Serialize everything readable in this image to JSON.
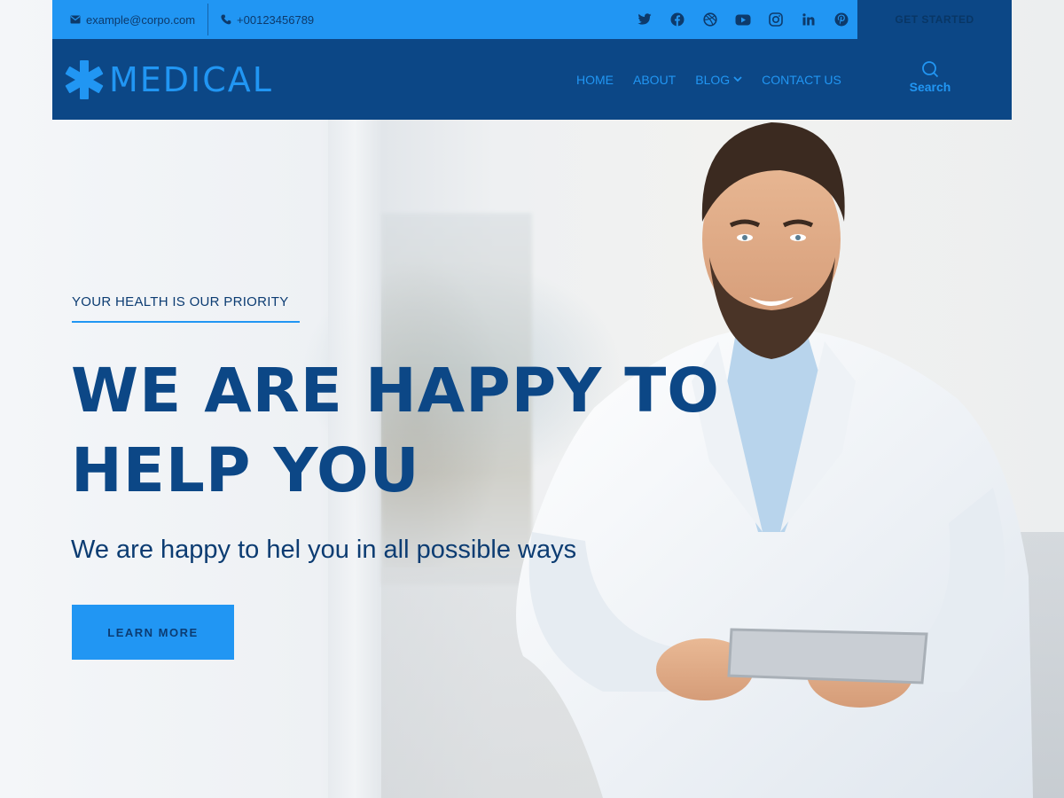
{
  "topbar": {
    "email": "example@corpo.com",
    "phone": "+00123456789",
    "socials": [
      "twitter-icon",
      "facebook-icon",
      "dribbble-icon",
      "youtube-icon",
      "instagram-icon",
      "linkedin-icon",
      "pinterest-icon"
    ],
    "cta_label": "GET STARTED"
  },
  "nav": {
    "logo_text": "MEDICAL",
    "links": [
      {
        "label": "HOME"
      },
      {
        "label": "ABOUT"
      },
      {
        "label": "BLOG"
      },
      {
        "label": "CONTACT US"
      }
    ],
    "search_label": "Search"
  },
  "hero": {
    "tagline": "YOUR HEALTH IS OUR PRIORITY",
    "headline": "WE ARE HAPPY TO HELP YOU",
    "subtitle": "We are happy to hel you in all possible ways",
    "cta_label": "LEARN MORE"
  },
  "colors": {
    "primary": "#2196f3",
    "dark": "#0c4786",
    "text_dark": "#0c3c72"
  }
}
